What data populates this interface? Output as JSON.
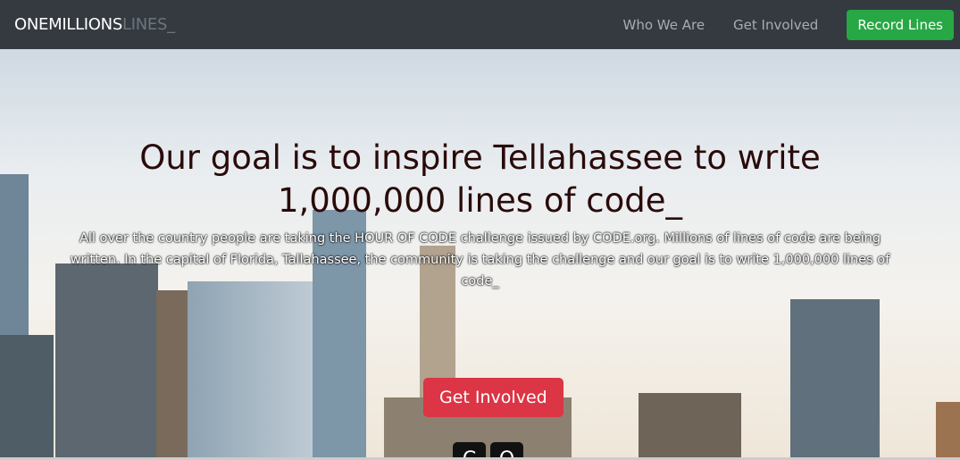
{
  "nav": {
    "brand_bold": "ONEMILLIONS",
    "brand_dim": "LINES_",
    "links": [
      "Who We Are",
      "Get Involved"
    ],
    "cta": "Record Lines"
  },
  "hero": {
    "title": "Our goal is to inspire Tellahassee to write 1,000,000 lines of code_",
    "subtitle": "All over the country people are taking the HOUR OF CODE challenge issued by CODE.org. Millions of lines of code are being written. In the capital of Florida, Tallahassee, the community is taking the challenge and our goal is to write 1,000,000 lines of code_",
    "button": "Get Involved"
  },
  "colors": {
    "nav": "#343a40",
    "record": "#28a745",
    "get_involved": "#dc3545"
  }
}
